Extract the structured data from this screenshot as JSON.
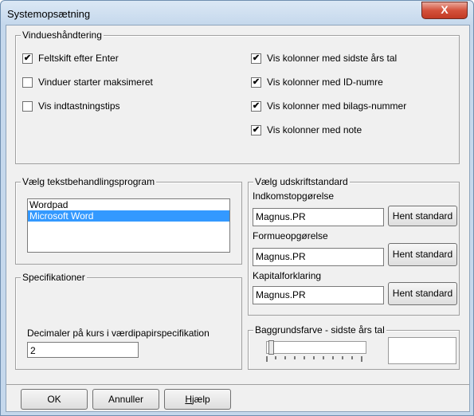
{
  "window": {
    "title": "Systemopsætning",
    "close_glyph": "X"
  },
  "vindue": {
    "legend": "Vindueshåndtering",
    "left": [
      {
        "label": "Feltskift efter Enter",
        "checked": true
      },
      {
        "label": "Vinduer starter maksimeret",
        "checked": false
      },
      {
        "label": "Vis indtastningstips",
        "checked": false
      }
    ],
    "right": [
      {
        "label": "Vis kolonner med sidste års tal",
        "checked": true
      },
      {
        "label": "Vis kolonner med ID-numre",
        "checked": true
      },
      {
        "label": "Vis kolonner med bilags-nummer",
        "checked": true
      },
      {
        "label": "Vis kolonner med note",
        "checked": true
      }
    ]
  },
  "tekst": {
    "legend": "Vælg tekstbehandlingsprogram",
    "items": [
      "Wordpad",
      "Microsoft Word"
    ],
    "selected": "Microsoft Word"
  },
  "spec": {
    "legend": "Specifikationer",
    "decimals_label": "Decimaler på kurs i værdipapirspecifikation",
    "decimals_value": "2"
  },
  "udskrift": {
    "legend": "Vælg udskriftstandard",
    "rows": [
      {
        "label": "Indkomstopgørelse",
        "value": "Magnus.PR",
        "button": "Hent standard"
      },
      {
        "label": "Formueopgørelse",
        "value": "Magnus.PR",
        "button": "Hent standard"
      },
      {
        "label": "Kapitalforklaring",
        "value": "Magnus.PR",
        "button": "Hent standard"
      }
    ]
  },
  "bg": {
    "legend": "Baggrundsfarve - sidste års tal",
    "slider_value": 0
  },
  "buttons": {
    "ok": "OK",
    "cancel": "Annuller",
    "help_first": "H",
    "help_rest": "jælp"
  }
}
